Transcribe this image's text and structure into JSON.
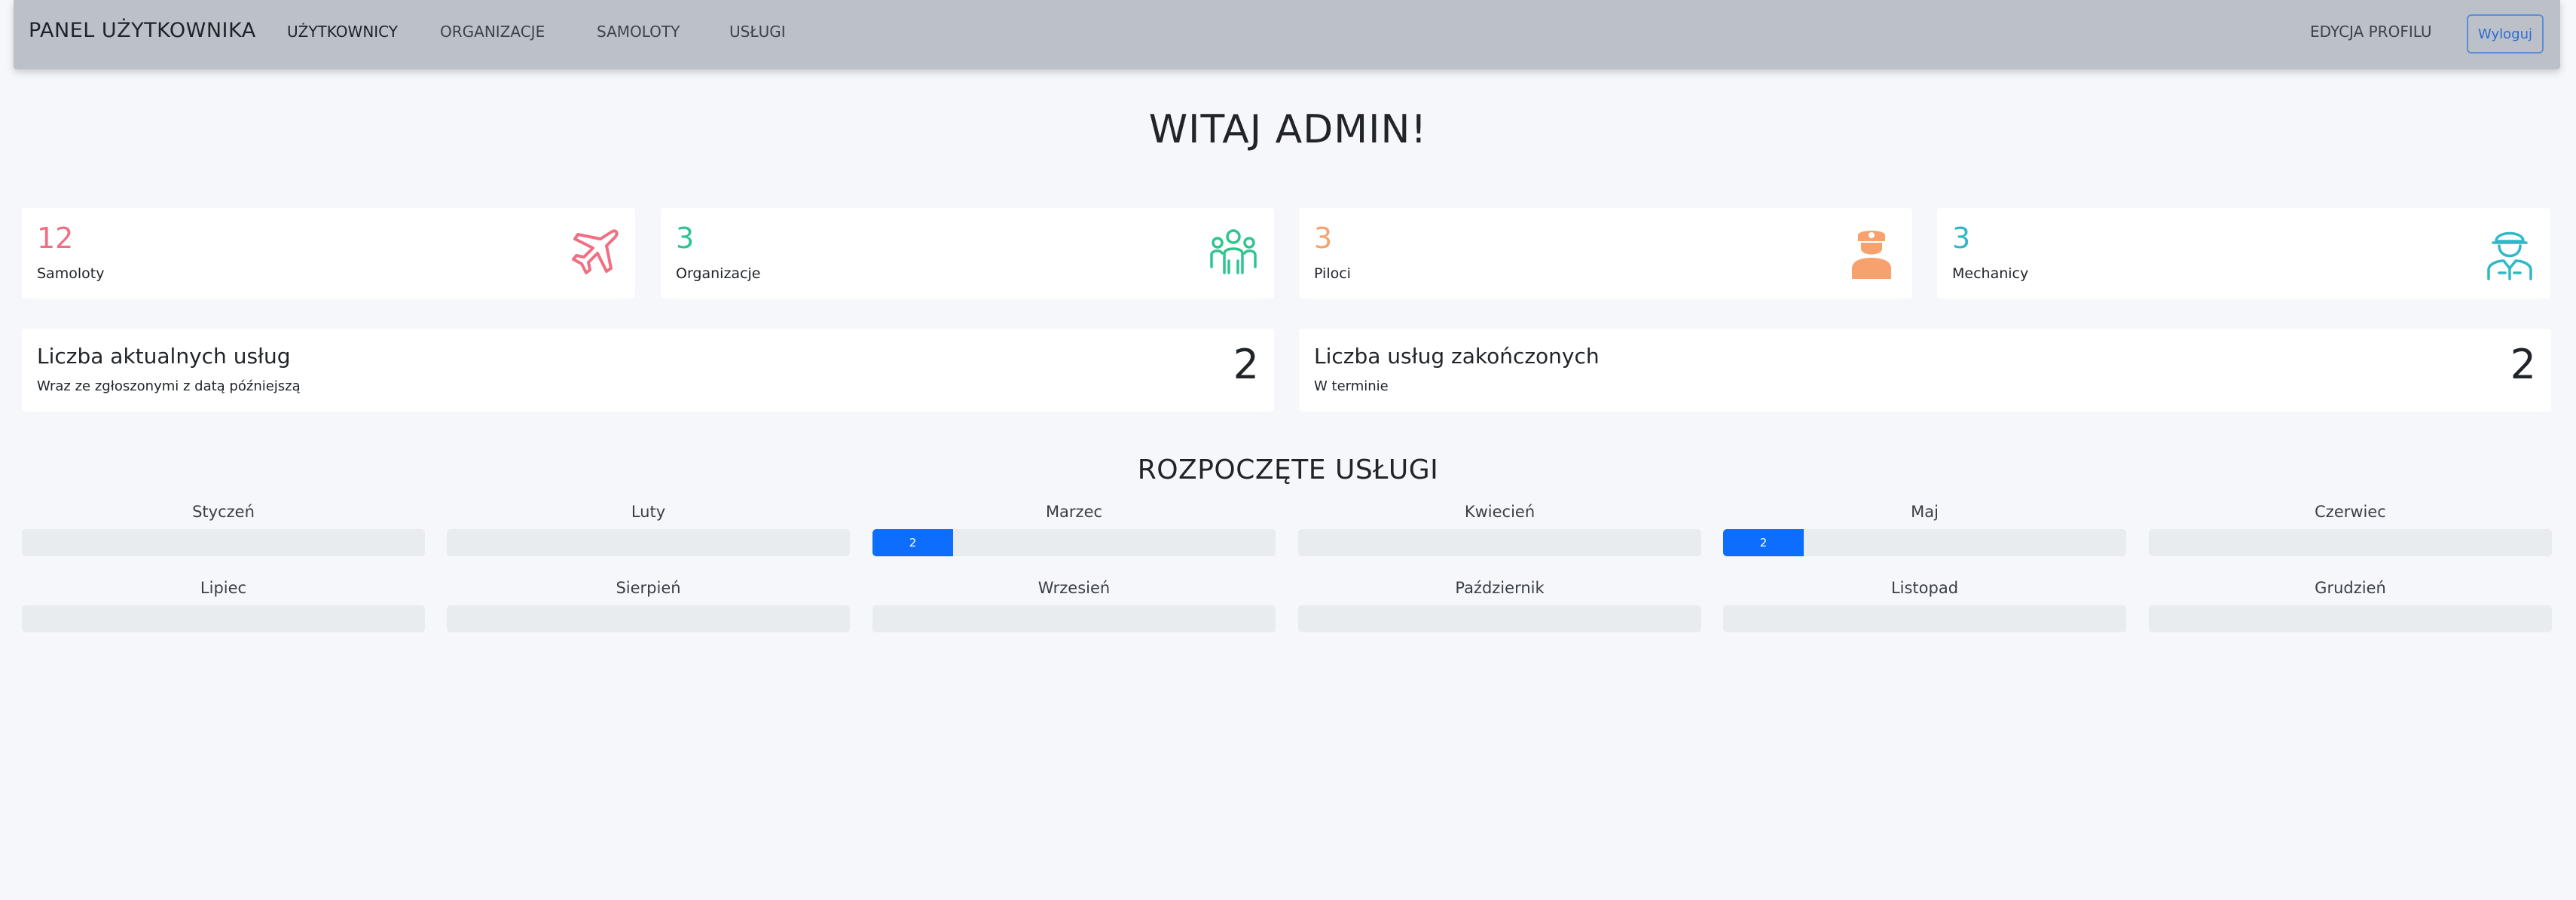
{
  "navbar": {
    "brand": "PANEL UŻYTKOWNIKA",
    "links": [
      "UŻYTKOWNICY",
      "ORGANIZACJE",
      "SAMOLOTY",
      "USŁUGI"
    ],
    "edit_profile": "EDYCJA PROFILU",
    "logout": "Wyloguj"
  },
  "welcome": "WITAJ ADMIN!",
  "stats": [
    {
      "value": "12",
      "label": "Samoloty",
      "icon": "airplane-icon",
      "color": "#f06f82"
    },
    {
      "value": "3",
      "label": "Organizacje",
      "icon": "people-group-icon",
      "color": "#2ec58f"
    },
    {
      "value": "3",
      "label": "Piloci",
      "icon": "pilot-icon",
      "color": "#f7a26e"
    },
    {
      "value": "3",
      "label": "Mechanicy",
      "icon": "mechanic-icon",
      "color": "#2fb9c8"
    }
  ],
  "summary": [
    {
      "title": "Liczba aktualnych usług",
      "subtitle": "Wraz ze zgłoszonymi z datą późniejszą",
      "value": "2"
    },
    {
      "title": "Liczba usług zakończonych",
      "subtitle": "W terminie",
      "value": "2"
    }
  ],
  "services_title": "ROZPOCZĘTE USŁUGI",
  "months": [
    {
      "name": "Styczeń",
      "count": 0,
      "label": ""
    },
    {
      "name": "Luty",
      "count": 0,
      "label": ""
    },
    {
      "name": "Marzec",
      "count": 2,
      "label": "2"
    },
    {
      "name": "Kwiecień",
      "count": 0,
      "label": ""
    },
    {
      "name": "Maj",
      "count": 2,
      "label": "2"
    },
    {
      "name": "Czerwiec",
      "count": 0,
      "label": ""
    },
    {
      "name": "Lipiec",
      "count": 0,
      "label": ""
    },
    {
      "name": "Sierpień",
      "count": 0,
      "label": ""
    },
    {
      "name": "Wrzesień",
      "count": 0,
      "label": ""
    },
    {
      "name": "Październik",
      "count": 0,
      "label": ""
    },
    {
      "name": "Listopad",
      "count": 0,
      "label": ""
    },
    {
      "name": "Grudzień",
      "count": 0,
      "label": ""
    }
  ],
  "progress_fill_fraction": 0.2,
  "colors": {
    "navbar": "#bcc0c8",
    "progress": "#0d6efd",
    "logout": "#2f6bd1"
  }
}
